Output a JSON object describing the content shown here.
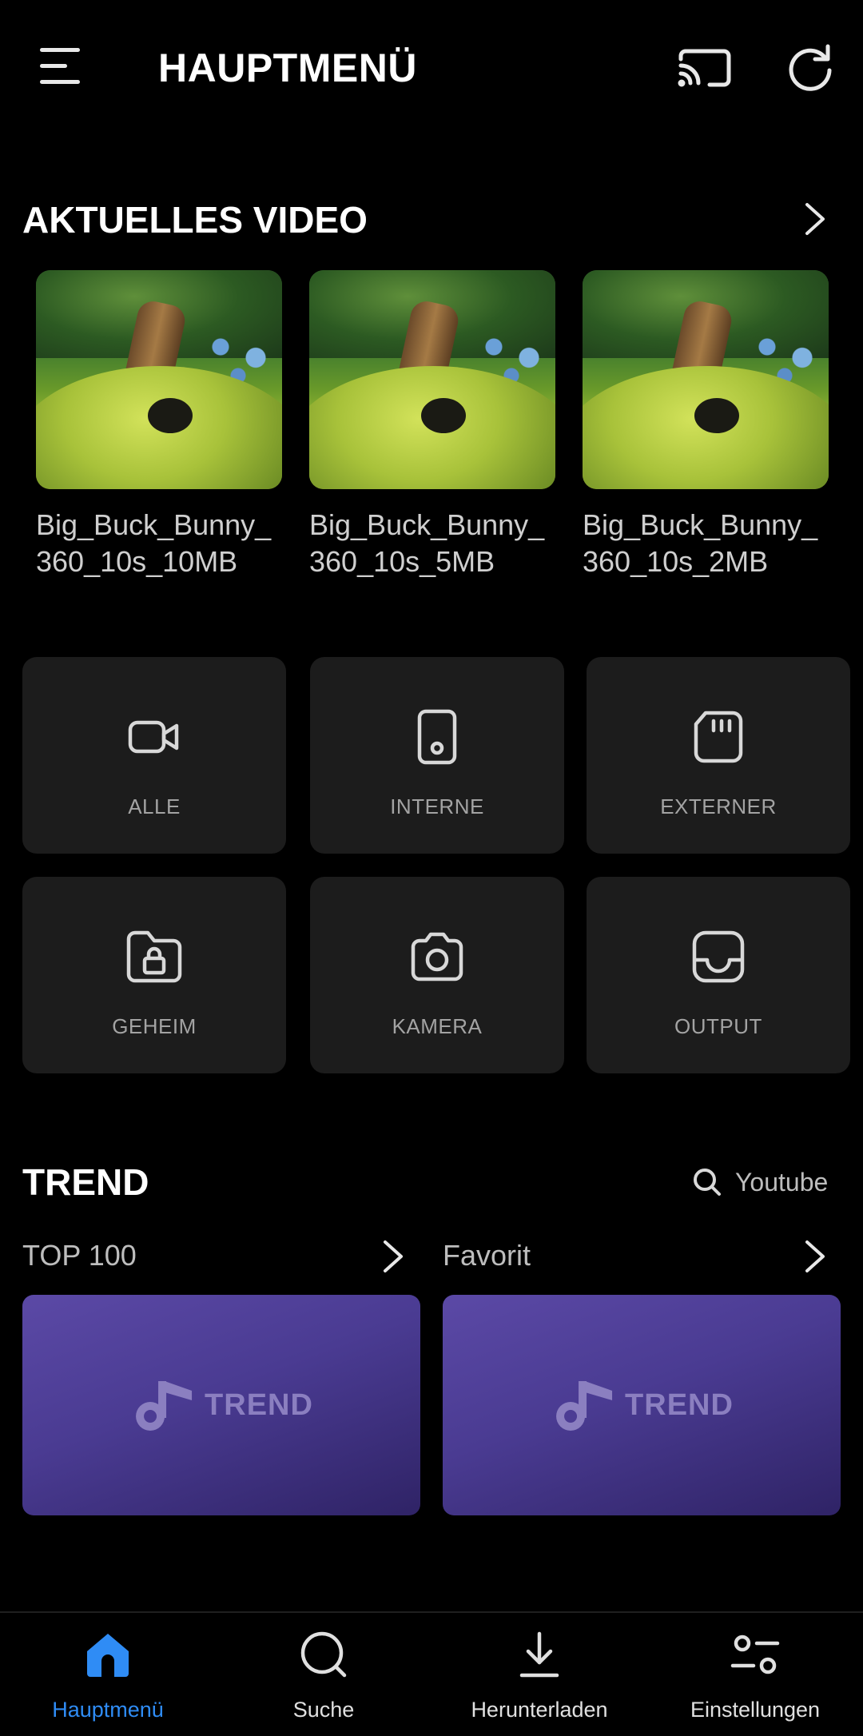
{
  "header": {
    "title": "HAUPTMENÜ",
    "icons": [
      "menu-icon",
      "cast-icon",
      "refresh-icon"
    ]
  },
  "recent": {
    "title": "AKTUELLES VIDEO",
    "videos": [
      {
        "name": "Big_Buck_Bunny_360_10s_10MB"
      },
      {
        "name": "Big_Buck_Bunny_360_10s_5MB"
      },
      {
        "name": "Big_Buck_Bunny_360_10s_2MB"
      }
    ]
  },
  "categories": [
    {
      "label": "ALLE",
      "icon": "video-camera-icon"
    },
    {
      "label": "INTERNE",
      "icon": "phone-icon"
    },
    {
      "label": "EXTERNER",
      "icon": "sd-card-icon"
    },
    {
      "label": "GEHEIM",
      "icon": "locked-folder-icon"
    },
    {
      "label": "KAMERA",
      "icon": "camera-icon"
    },
    {
      "label": "OUTPUT",
      "icon": "tray-icon"
    }
  ],
  "trend": {
    "title": "TREND",
    "search_label": "Youtube",
    "lists": [
      {
        "title": "TOP 100",
        "logo": "TREND"
      },
      {
        "title": "Favorit",
        "logo": "TREND"
      }
    ]
  },
  "nav": {
    "items": [
      {
        "label": "Hauptmenü",
        "icon": "home-icon"
      },
      {
        "label": "Suche",
        "icon": "search-icon"
      },
      {
        "label": "Herunterladen",
        "icon": "download-icon"
      },
      {
        "label": "Einstellungen",
        "icon": "settings-icon"
      }
    ],
    "active_color": "#2f8cf5"
  }
}
